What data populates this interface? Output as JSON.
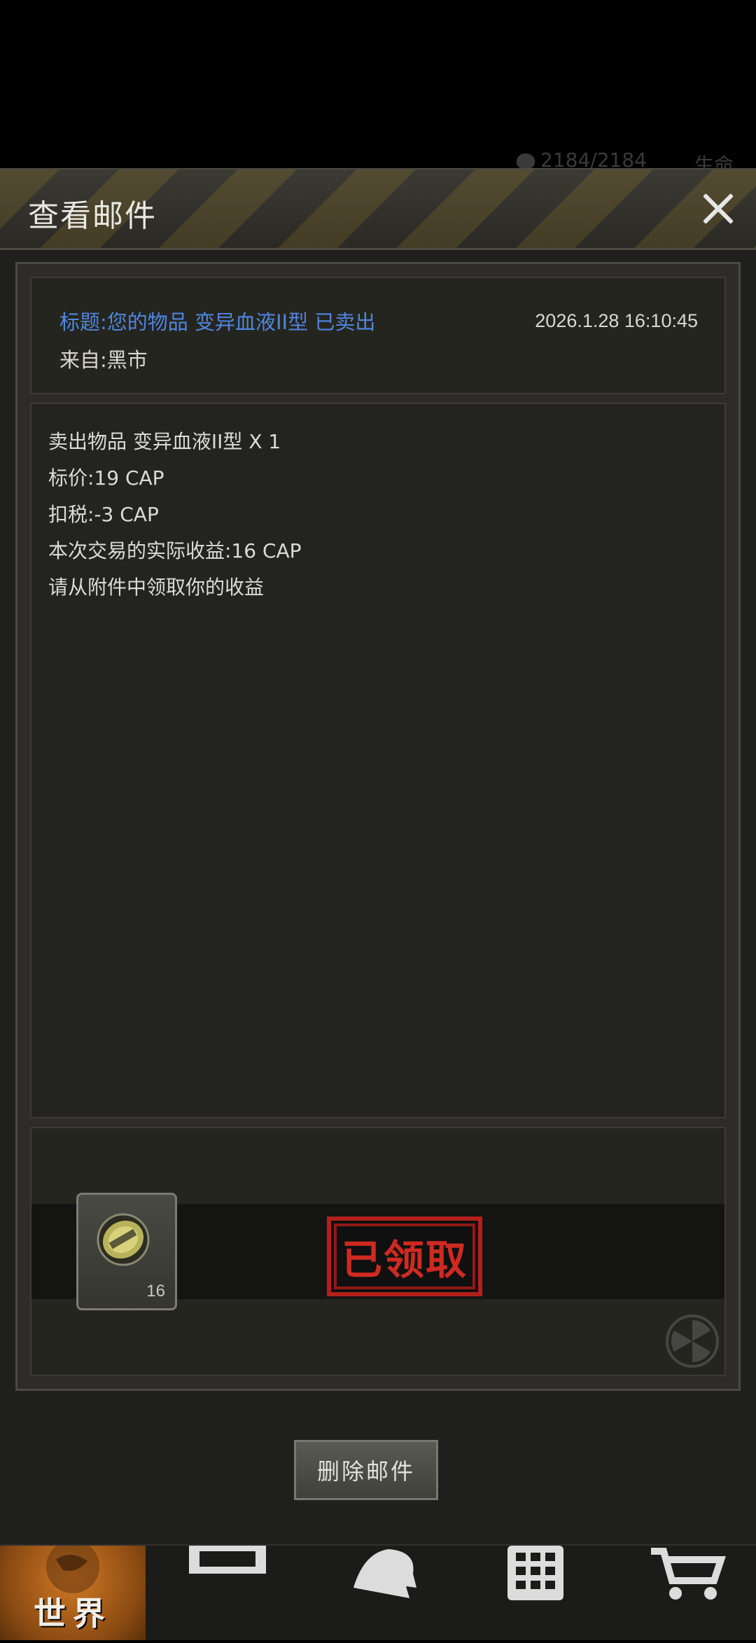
{
  "background_status": {
    "hp": "2184/2184",
    "label": "生命"
  },
  "header": {
    "title": "查看邮件"
  },
  "mail": {
    "subject": "标题:您的物品 变异血液II型 已卖出",
    "sender": "来自:黑市",
    "timestamp": "2026.1.28 16:10:45",
    "body_lines": [
      "卖出物品 变异血液II型 X 1",
      "标价:19 CAP",
      "扣税:-3 CAP",
      "本次交易的实际收益:16 CAP",
      "请从附件中领取你的收益"
    ]
  },
  "attachment": {
    "item_icon": "bottle-cap-icon",
    "count": "16",
    "claimed_label": "已领取"
  },
  "actions": {
    "delete_label": "删除邮件"
  },
  "nav": {
    "world_label": "世界",
    "items": [
      "backpack-icon",
      "character-icon",
      "building-icon",
      "cart-icon"
    ]
  },
  "colors": {
    "subject": "#4f86e0",
    "stamp": "#cf2a22",
    "world_tab": "#d07a25"
  }
}
